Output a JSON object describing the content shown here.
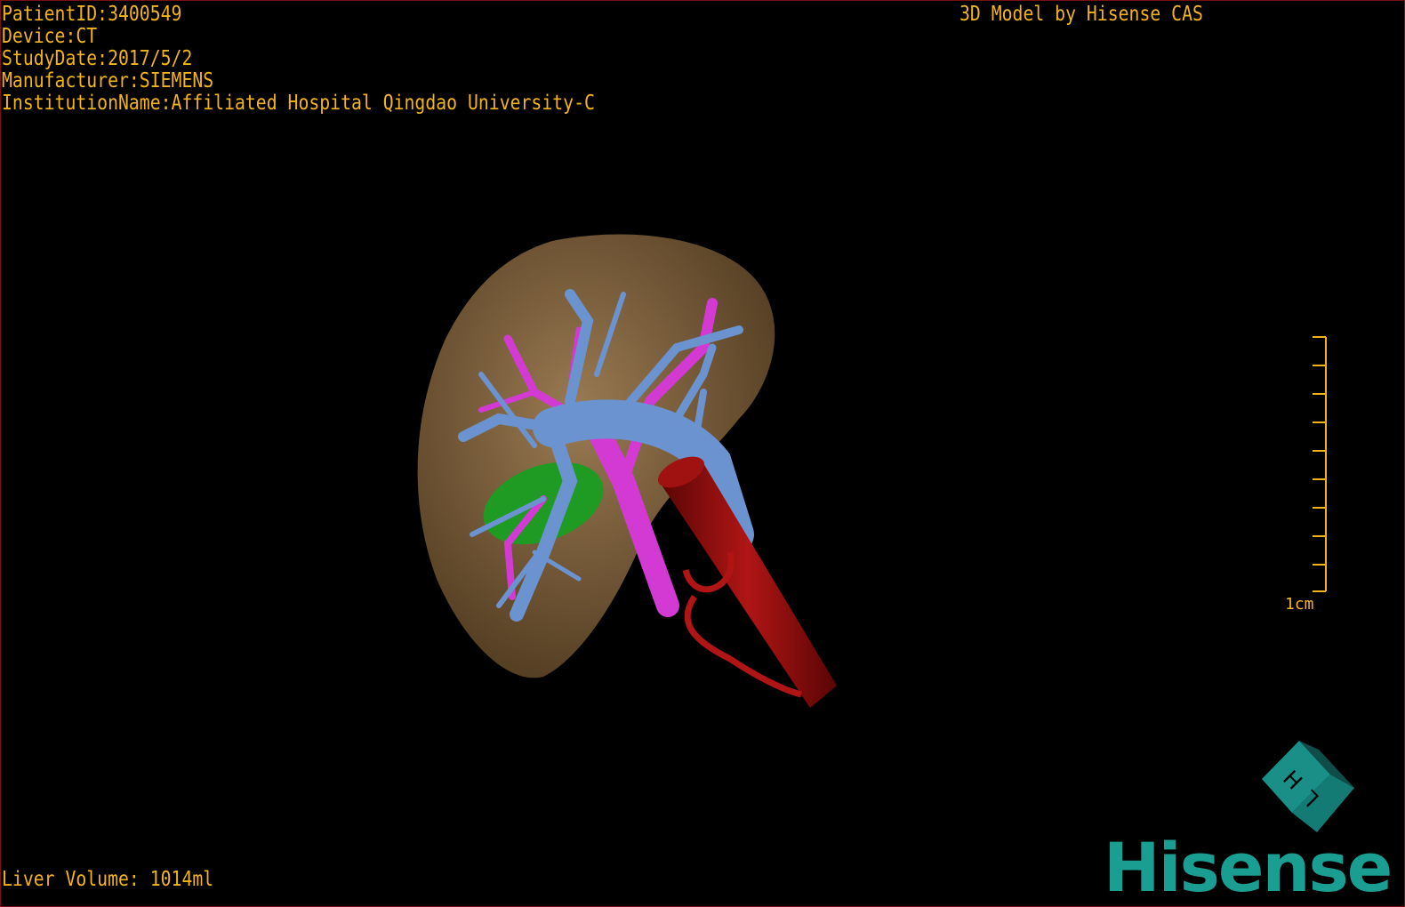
{
  "overlay": {
    "patient_id": "PatientID:3400549",
    "device": "Device:CT",
    "study_date": "StudyDate:2017/5/2",
    "manufacturer": "Manufacturer:SIEMENS",
    "institution": "InstitutionName:Affiliated Hospital Qingdao University-C",
    "brand_line": "3D Model by Hisense CAS",
    "liver_volume": "Liver Volume: 1014ml"
  },
  "scale": {
    "label": "1cm"
  },
  "logo": {
    "text": "Hisense",
    "cube_letters": [
      "H",
      "L"
    ]
  },
  "colors": {
    "text": "#f2b418",
    "liver": "#8a6b45",
    "portal_vein": "#6b93cf",
    "hepatic_artery": "#d33ad3",
    "ivc": "#9e0d0d",
    "gallbladder": "#1f9a22",
    "brand": "#1a9e92"
  }
}
